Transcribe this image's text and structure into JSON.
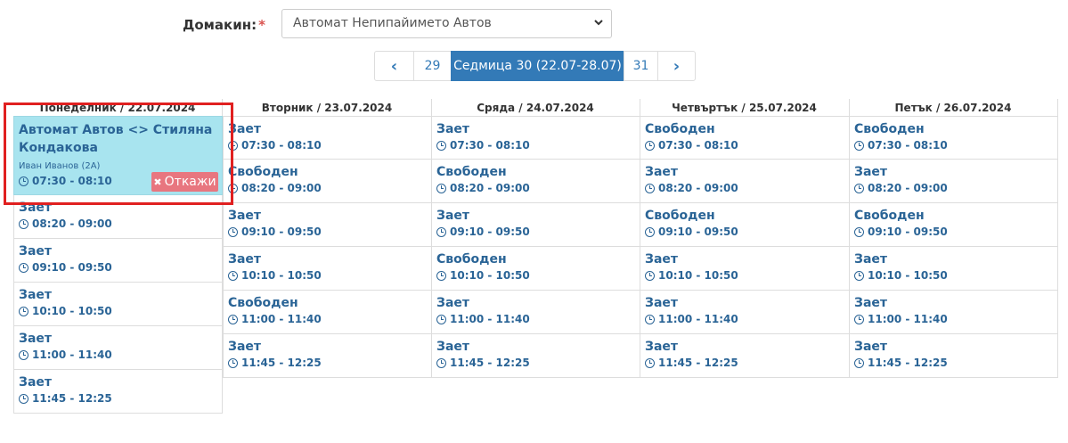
{
  "host": {
    "label": "Домакин:",
    "required_mark": "*",
    "selected": "Автомат Непипайимето Автов"
  },
  "pager": {
    "prev_icon": "‹",
    "prev_week": "29",
    "current": "Седмица 30 (22.07-28.07)",
    "next_week": "31",
    "next_icon": "›"
  },
  "booked": {
    "title": "Автомат Автов <> Стиляна Кондакова",
    "student": "Иван Иванов (2А)",
    "time": "07:30 - 08:10",
    "cancel_label": "Откажи",
    "cancel_icon": "✖"
  },
  "days": [
    {
      "header": "Понеделник / 22.07.2024",
      "slots": [
        {
          "status": "Зает",
          "time": "08:20 - 09:00"
        },
        {
          "status": "Зает",
          "time": "09:10 - 09:50"
        },
        {
          "status": "Зает",
          "time": "10:10 - 10:50"
        },
        {
          "status": "Зает",
          "time": "11:00 - 11:40"
        },
        {
          "status": "Зает",
          "time": "11:45 - 12:25"
        }
      ]
    },
    {
      "header": "Вторник / 23.07.2024",
      "slots": [
        {
          "status": "Зает",
          "time": "07:30 - 08:10"
        },
        {
          "status": "Свободен",
          "time": "08:20 - 09:00"
        },
        {
          "status": "Зает",
          "time": "09:10 - 09:50"
        },
        {
          "status": "Зает",
          "time": "10:10 - 10:50"
        },
        {
          "status": "Свободен",
          "time": "11:00 - 11:40"
        },
        {
          "status": "Зает",
          "time": "11:45 - 12:25"
        }
      ]
    },
    {
      "header": "Сряда / 24.07.2024",
      "slots": [
        {
          "status": "Зает",
          "time": "07:30 - 08:10"
        },
        {
          "status": "Свободен",
          "time": "08:20 - 09:00"
        },
        {
          "status": "Зает",
          "time": "09:10 - 09:50"
        },
        {
          "status": "Свободен",
          "time": "10:10 - 10:50"
        },
        {
          "status": "Зает",
          "time": "11:00 - 11:40"
        },
        {
          "status": "Зает",
          "time": "11:45 - 12:25"
        }
      ]
    },
    {
      "header": "Четвъртък / 25.07.2024",
      "slots": [
        {
          "status": "Свободен",
          "time": "07:30 - 08:10"
        },
        {
          "status": "Зает",
          "time": "08:20 - 09:00"
        },
        {
          "status": "Свободен",
          "time": "09:10 - 09:50"
        },
        {
          "status": "Зает",
          "time": "10:10 - 10:50"
        },
        {
          "status": "Зает",
          "time": "11:00 - 11:40"
        },
        {
          "status": "Зает",
          "time": "11:45 - 12:25"
        }
      ]
    },
    {
      "header": "Петък / 26.07.2024",
      "slots": [
        {
          "status": "Свободен",
          "time": "07:30 - 08:10"
        },
        {
          "status": "Зает",
          "time": "08:20 - 09:00"
        },
        {
          "status": "Свободен",
          "time": "09:10 - 09:50"
        },
        {
          "status": "Зает",
          "time": "10:10 - 10:50"
        },
        {
          "status": "Зает",
          "time": "11:00 - 11:40"
        },
        {
          "status": "Зает",
          "time": "11:45 - 12:25"
        }
      ]
    }
  ]
}
